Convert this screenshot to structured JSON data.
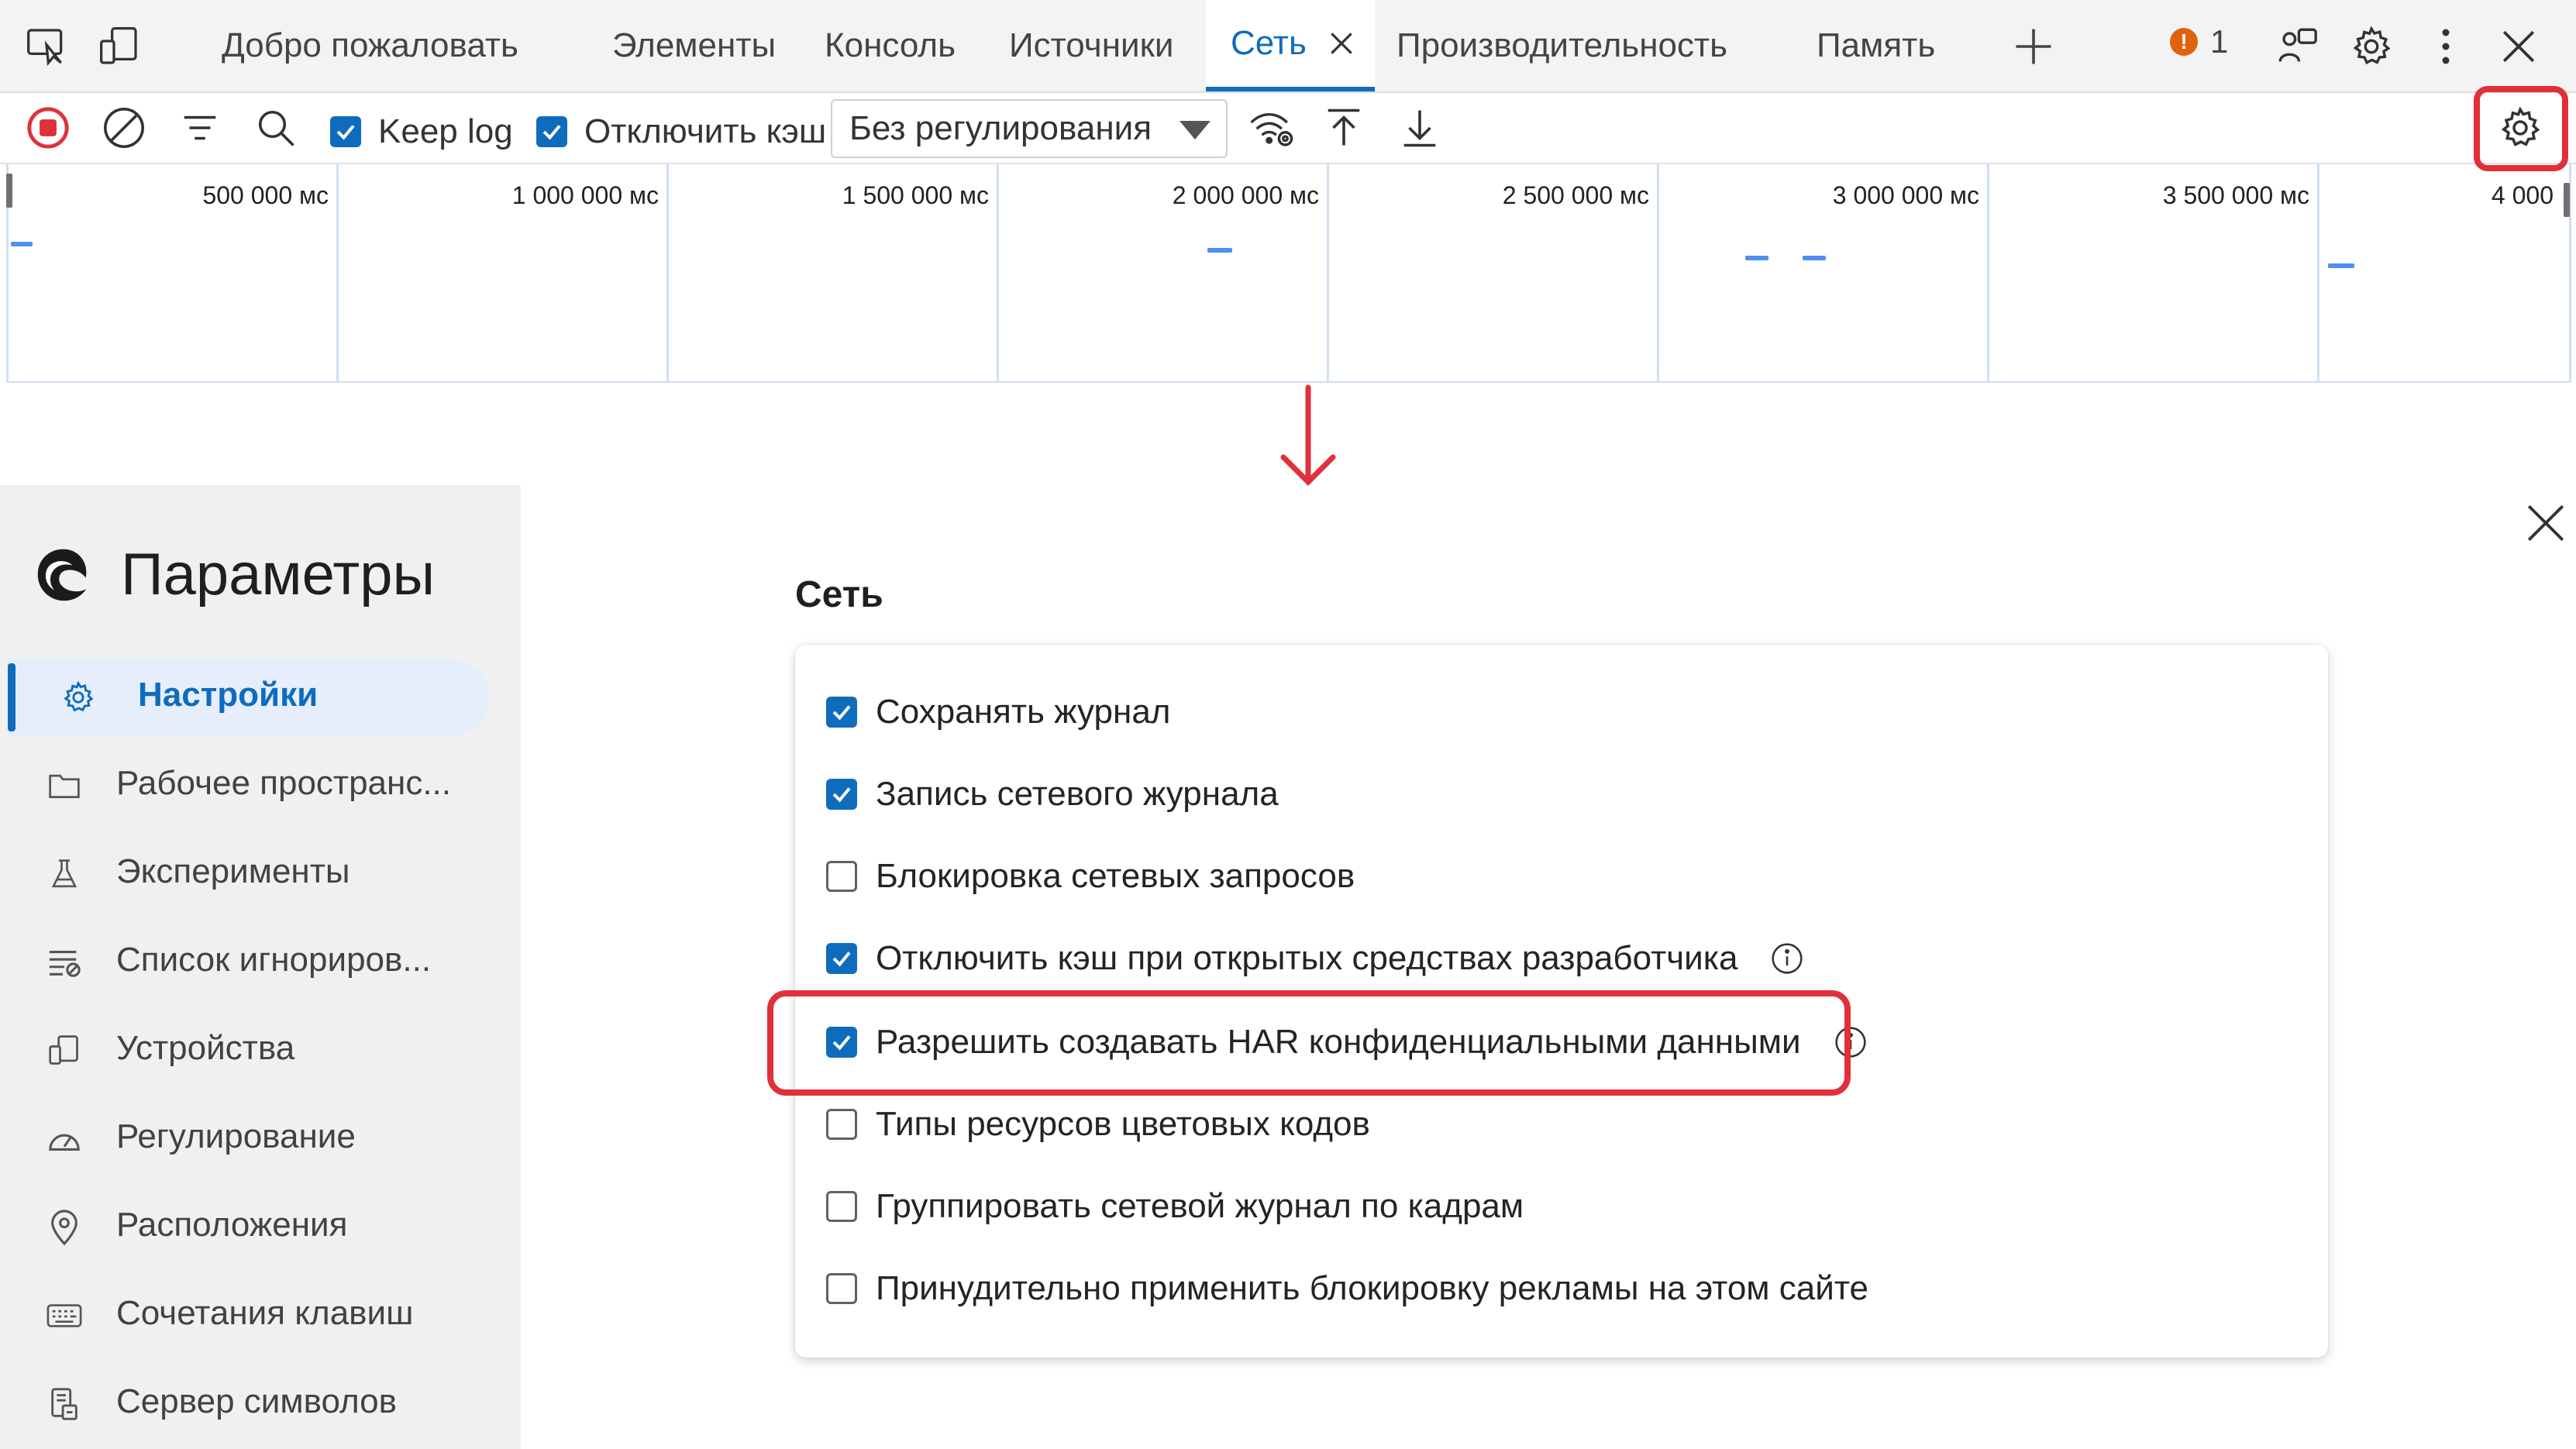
{
  "tabs": [
    {
      "label": "Добро пожаловать",
      "active": false
    },
    {
      "label": "Элементы",
      "active": false
    },
    {
      "label": "Консоль",
      "active": false
    },
    {
      "label": "Источники",
      "active": false
    },
    {
      "label": "Сеть",
      "active": true
    },
    {
      "label": "Производительность",
      "active": false
    },
    {
      "label": "Память",
      "active": false
    }
  ],
  "issues_count": "1",
  "toolbar": {
    "keep_log_label": "Keep log",
    "keep_log_checked": true,
    "disable_cache_label": "Отключить кэш",
    "disable_cache_checked": true,
    "throttling_value": "Без регулирования"
  },
  "overview": {
    "tick_labels": [
      "500 000 мс",
      "1 000 000 мс",
      "1 500 000 мс",
      "2 000 000 мс",
      "2 500 000 мс",
      "3 000 000 мс",
      "3 500 000 мс",
      "4 000"
    ]
  },
  "settings": {
    "title": "Параметры",
    "nav": [
      {
        "label": "Настройки",
        "icon": "gear-icon",
        "selected": true
      },
      {
        "label": "Рабочее пространс...",
        "icon": "folder-icon",
        "selected": false
      },
      {
        "label": "Эксперименты",
        "icon": "flask-icon",
        "selected": false
      },
      {
        "label": "Список игнориров...",
        "icon": "ignore-list-icon",
        "selected": false
      },
      {
        "label": "Устройства",
        "icon": "devices-icon",
        "selected": false
      },
      {
        "label": "Регулирование",
        "icon": "gauge-icon",
        "selected": false
      },
      {
        "label": "Расположения",
        "icon": "location-pin-icon",
        "selected": false
      },
      {
        "label": "Сочетания клавиш",
        "icon": "keyboard-icon",
        "selected": false
      },
      {
        "label": "Сервер символов",
        "icon": "symbol-server-icon",
        "selected": false
      }
    ],
    "section_title": "Сеть",
    "options": [
      {
        "label": "Сохранять журнал",
        "checked": true,
        "info": false
      },
      {
        "label": "Запись сетевого журнала",
        "checked": true,
        "info": false
      },
      {
        "label": "Блокировка сетевых запросов",
        "checked": false,
        "info": false
      },
      {
        "label": "Отключить кэш при открытых средствах разработчика",
        "checked": true,
        "info": true
      },
      {
        "label": "Разрешить создавать HAR конфиденциальными данными",
        "checked": true,
        "info": true
      },
      {
        "label": "Типы ресурсов цветовых кодов",
        "checked": false,
        "info": false
      },
      {
        "label": "Группировать сетевой журнал по кадрам",
        "checked": false,
        "info": false
      },
      {
        "label": "Принудительно применить блокировку рекламы на этом сайте",
        "checked": false,
        "info": false
      }
    ]
  },
  "colors": {
    "accent": "#0f6cbd",
    "highlight": "#e0303a",
    "record": "#e0303a",
    "issue_badge": "#e0620c"
  }
}
